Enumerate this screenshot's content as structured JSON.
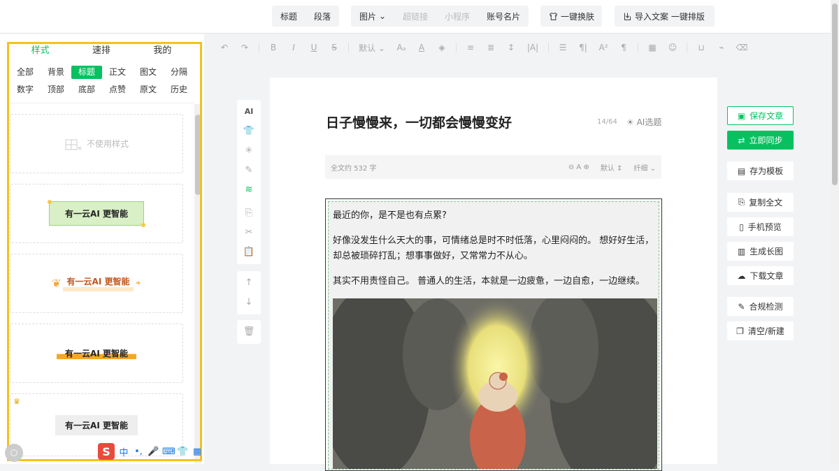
{
  "topbar": {
    "group1": [
      "标题",
      "段落"
    ],
    "group2": [
      {
        "label": "图片",
        "disabled": false,
        "caret": true
      },
      {
        "label": "超链接",
        "disabled": true
      },
      {
        "label": "小程序",
        "disabled": true
      },
      {
        "label": "账号名片",
        "disabled": false
      }
    ],
    "skin_label": "一键换肤",
    "import_label": "导入文案 一键排版"
  },
  "left": {
    "tabs": [
      "样式",
      "速排",
      "我的"
    ],
    "categories": [
      "全部",
      "背景",
      "标题",
      "正文",
      "图文",
      "分隔",
      "数字",
      "顶部",
      "底部",
      "点赞",
      "原文",
      "历史"
    ],
    "active_category": "标题",
    "no_style_label": "不使用样式",
    "sample_text": "有一云AI 更智能",
    "highlight_color": "#f5c21b"
  },
  "editor": {
    "toolbar": [
      "↶",
      "↷",
      "B",
      "I",
      "U",
      "S",
      "默认 ⌄",
      "Aₐ",
      "A",
      "◈",
      "≡",
      "≣",
      "↕",
      "|A|",
      "☰",
      "¶|",
      "A²",
      "¶",
      "▦",
      "☺",
      "⊔",
      "⌁",
      "⌫"
    ],
    "side_tools_1": [
      "AI",
      "👕",
      "✳",
      "✎",
      "≋"
    ],
    "side_tools_2": [
      "⎘",
      "✂",
      "📋"
    ],
    "side_tools_3": [
      "↑",
      "↓"
    ],
    "side_tools_4": [
      "🗑"
    ],
    "title": "日子慢慢来，一切都会慢慢变好",
    "count": "14/64",
    "ai_title_label": "AI选题",
    "word_count": "全文约 532 字",
    "font_size_label": "A",
    "default_label": "默认",
    "spacing_label": "纤细",
    "paragraphs": [
      "最近的你，是不是也有点累?",
      "好像没发生什么天大的事，可情绪总是时不时低落，心里闷闷的。 想好好生活，却总被琐碎打乱；想事事做好，又常常力不从心。",
      "其实不用责怪自己。 普通人的生活，本就是一边疲惫，一边自愈，一边继续。"
    ]
  },
  "right": {
    "save": "保存文章",
    "sync": "立即同步",
    "template": "存为模板",
    "copy": "复制全文",
    "preview": "手机预览",
    "longimg": "生成长图",
    "download": "下载文章",
    "check": "合规检测",
    "clear": "清空/新建"
  },
  "ime": {
    "logo": "S",
    "lang": "中",
    "items": [
      "•,",
      "🎤",
      "⌨",
      "👕",
      "▦"
    ]
  },
  "accent": "#07c160"
}
